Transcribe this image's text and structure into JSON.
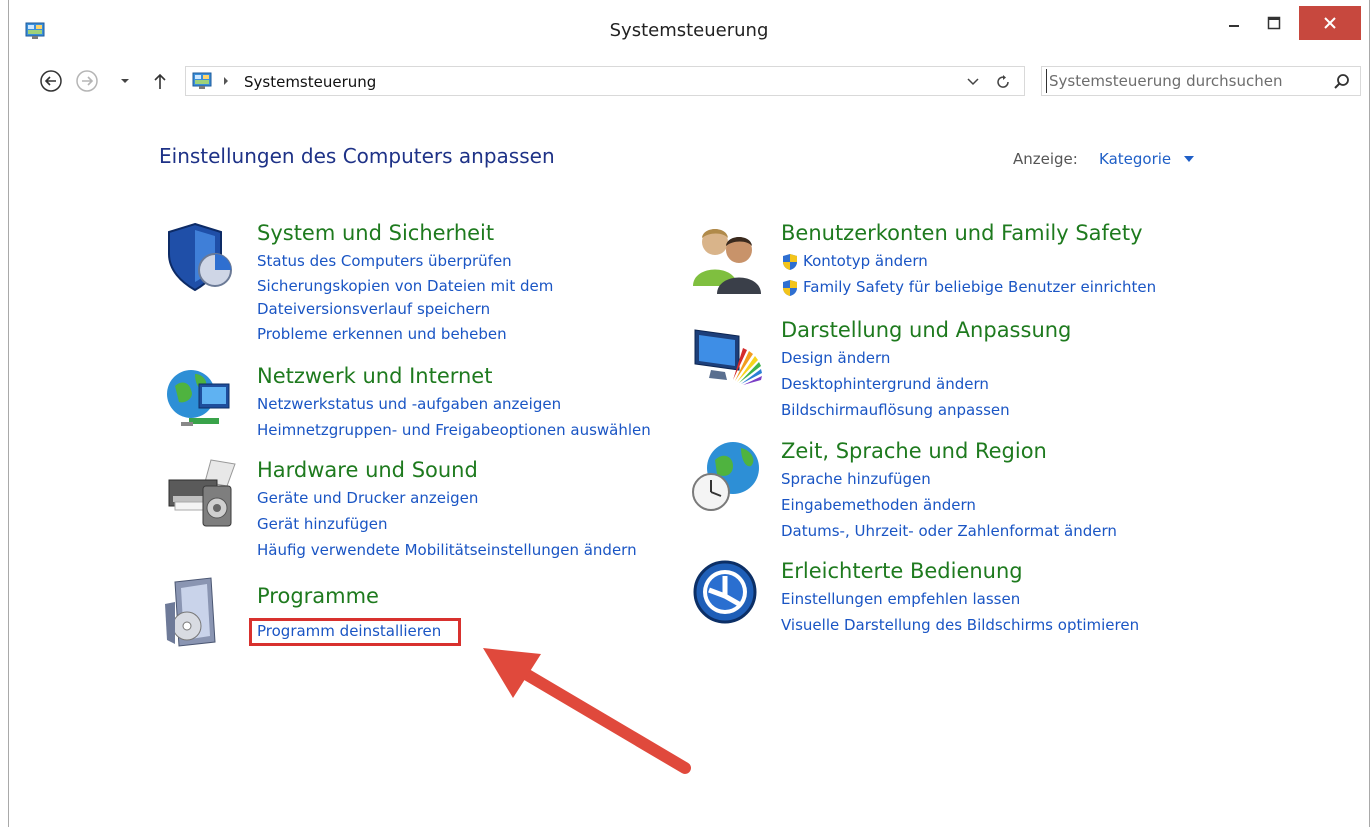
{
  "window": {
    "title": "Systemsteuerung"
  },
  "addressbar": {
    "path": "Systemsteuerung",
    "search_placeholder": "Systemsteuerung durchsuchen"
  },
  "main": {
    "heading": "Einstellungen des Computers anpassen",
    "view_label": "Anzeige:",
    "view_value": "Kategorie"
  },
  "categories": {
    "system": {
      "title": "System und Sicherheit",
      "icon": "shield-pie-icon",
      "links": [
        "Status des Computers überprüfen",
        "Sicherungskopien von Dateien mit dem",
        "Dateiversionsverlauf speichern",
        "Probleme erkennen und beheben"
      ]
    },
    "network": {
      "title": "Netzwerk und Internet",
      "icon": "globe-network-icon",
      "links": [
        "Netzwerkstatus und -aufgaben anzeigen",
        "Heimnetzgruppen- und Freigabeoptionen auswählen"
      ]
    },
    "hardware": {
      "title": "Hardware und Sound",
      "icon": "printer-speaker-icon",
      "links": [
        "Geräte und Drucker anzeigen",
        "Gerät hinzufügen",
        "Häufig verwendete Mobilitätseinstellungen ändern"
      ]
    },
    "programs": {
      "title": "Programme",
      "icon": "programs-box-icon",
      "links": [
        "Programm deinstallieren"
      ]
    },
    "users": {
      "title": "Benutzerkonten und Family Safety",
      "icon": "users-icon",
      "links": [
        "Kontotyp ändern",
        "Family Safety für beliebige Benutzer einrichten"
      ]
    },
    "appearance": {
      "title": "Darstellung und Anpassung",
      "icon": "monitor-palette-icon",
      "links": [
        "Design ändern",
        "Desktophintergrund ändern",
        "Bildschirmauflösung anpassen"
      ]
    },
    "region": {
      "title": "Zeit, Sprache und Region",
      "icon": "globe-clock-icon",
      "links": [
        "Sprache hinzufügen",
        "Eingabemethoden ändern",
        "Datums-, Uhrzeit- oder Zahlenformat ändern"
      ]
    },
    "access": {
      "title": "Erleichterte Bedienung",
      "icon": "ease-of-access-icon",
      "links": [
        "Einstellungen empfehlen lassen",
        "Visuelle Darstellung des Bildschirms optimieren"
      ]
    }
  },
  "colors": {
    "category_title": "#1e7a1e",
    "link": "#1a55c4",
    "heading": "#1e3287",
    "close_button": "#c7483e",
    "highlight": "#d8312e"
  }
}
